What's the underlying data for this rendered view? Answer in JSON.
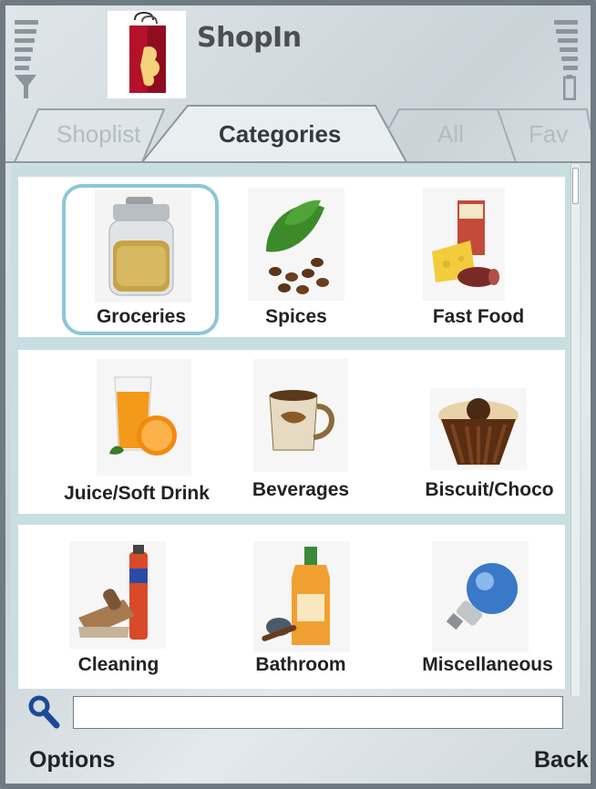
{
  "app": {
    "title": "ShopIn"
  },
  "tabs": [
    {
      "label": "Shoplist",
      "active": false
    },
    {
      "label": "Categories",
      "active": true
    },
    {
      "label": "All",
      "active": false
    },
    {
      "label": "Fav",
      "active": false
    }
  ],
  "categories": [
    {
      "label": "Groceries",
      "icon": "grocery-jar-icon",
      "selected": true
    },
    {
      "label": "Spices",
      "icon": "coffee-beans-leaf-icon",
      "selected": false
    },
    {
      "label": "Fast Food",
      "icon": "cheese-sausage-icon",
      "selected": false
    },
    {
      "label": "Juice/Soft Drink",
      "icon": "orange-juice-icon",
      "selected": false
    },
    {
      "label": "Beverages",
      "icon": "coffee-mug-icon",
      "selected": false
    },
    {
      "label": "Biscuit/Choco",
      "icon": "chocolate-praline-icon",
      "selected": false
    },
    {
      "label": "Cleaning",
      "icon": "brush-spray-icon",
      "selected": false
    },
    {
      "label": "Bathroom",
      "icon": "shampoo-brush-icon",
      "selected": false
    },
    {
      "label": "Miscellaneous",
      "icon": "light-bulb-icon",
      "selected": false
    }
  ],
  "search": {
    "value": "",
    "placeholder": ""
  },
  "softkeys": {
    "left": "Options",
    "right": "Back"
  },
  "colors": {
    "selection": "#8dc6d8",
    "background": "#c7dfe0"
  }
}
